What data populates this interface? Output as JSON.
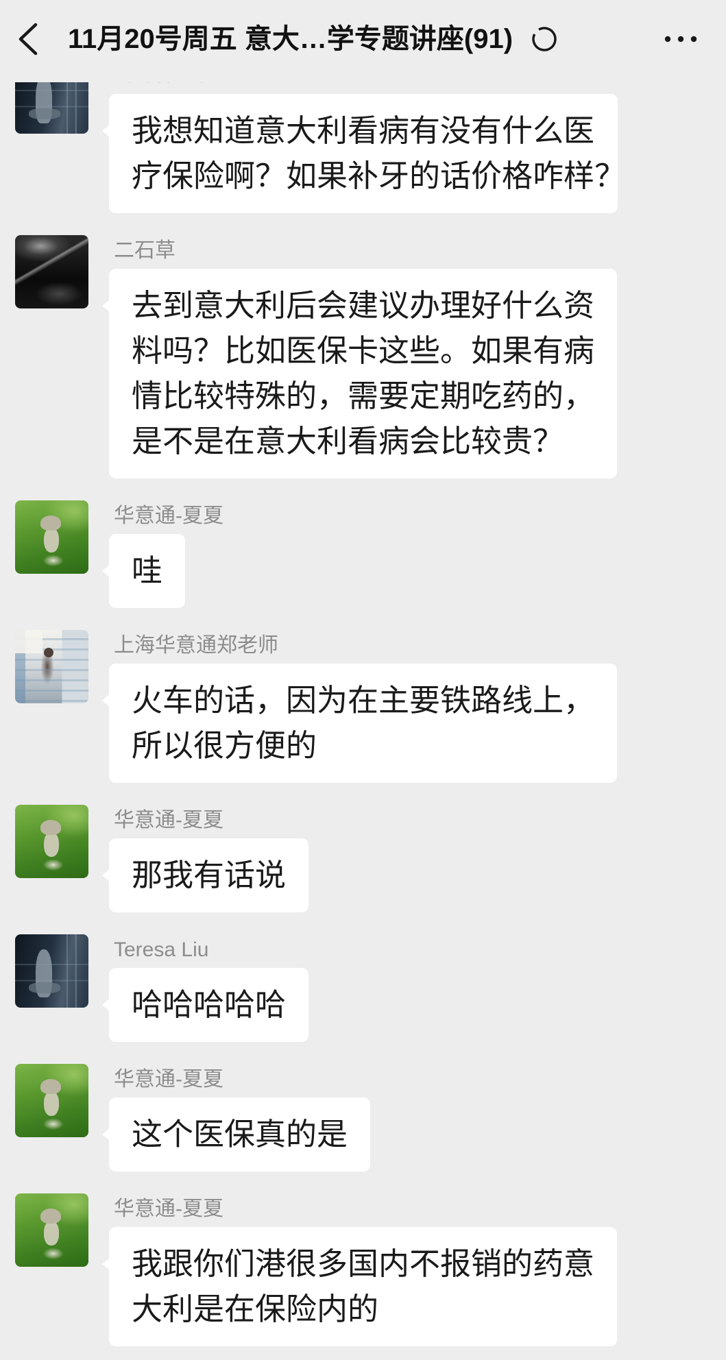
{
  "header": {
    "title": "11月20号周五 意大…学专题讲座(91)",
    "back_icon": "chevron-left-icon",
    "status_icon": "loading-ring-icon",
    "more_icon": "more-dots-icon"
  },
  "colors": {
    "background": "#ededed",
    "bubble": "#ffffff",
    "sender_name": "#8c8c8c",
    "message_text": "#1a1a1a",
    "title_text": "#111111"
  },
  "messages": [
    {
      "sender": "Teresa Liu",
      "lines": [
        "我想知道意大利看病有没有什么医",
        "疗保险啊？如果补牙的话价格咋样？"
      ]
    },
    {
      "sender": "二石草",
      "lines": [
        "去到意大利后会建议办理好什么资",
        "料吗？比如医保卡这些。如果有病",
        "情比较特殊的，需要定期吃药的，",
        "是不是在意大利看病会比较贵？"
      ]
    },
    {
      "sender": "华意通-夏夏",
      "lines": [
        "哇"
      ]
    },
    {
      "sender": "上海华意通郑老师",
      "lines": [
        "火车的话，因为在主要铁路线上，",
        "所以很方便的"
      ]
    },
    {
      "sender": "华意通-夏夏",
      "lines": [
        "那我有话说"
      ]
    },
    {
      "sender": "Teresa Liu",
      "lines": [
        "哈哈哈哈哈"
      ]
    },
    {
      "sender": "华意通-夏夏",
      "lines": [
        "这个医保真的是"
      ]
    },
    {
      "sender": "华意通-夏夏",
      "lines": [
        "我跟你们港很多国内不报销的药意",
        "大利是在保险内的"
      ]
    }
  ]
}
